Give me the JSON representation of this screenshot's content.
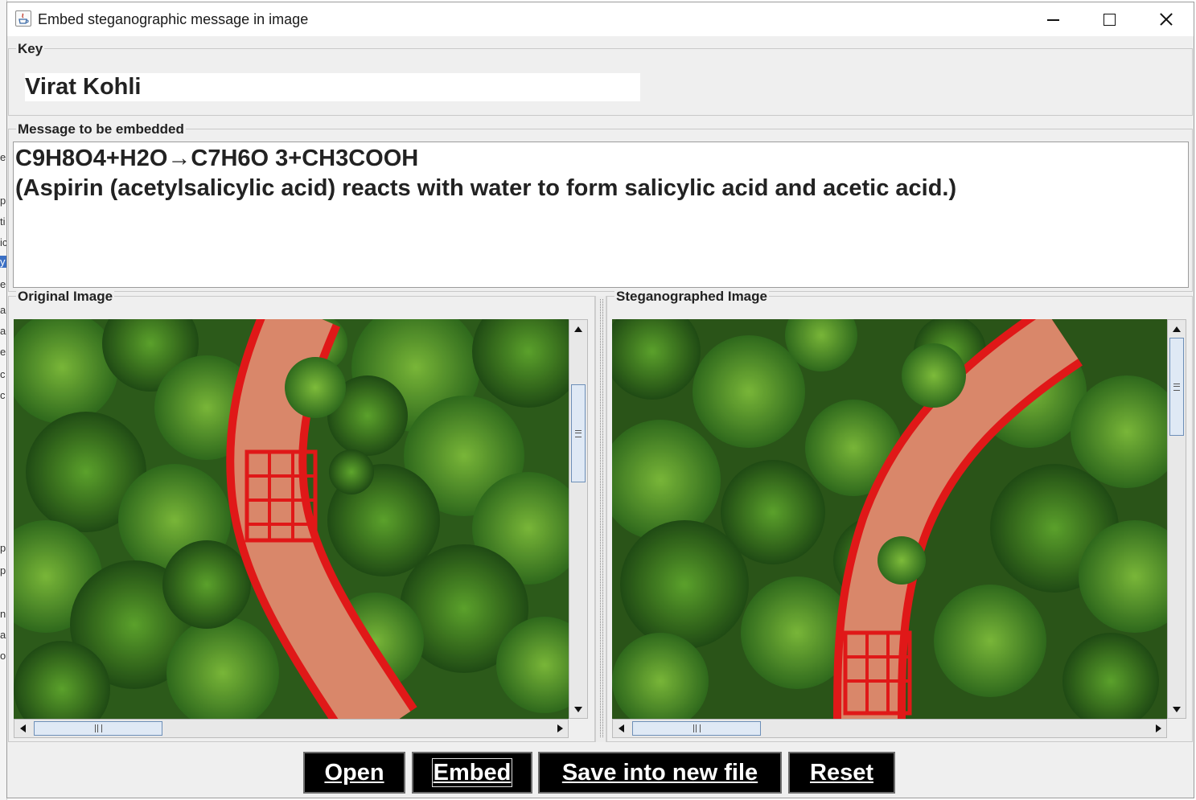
{
  "window": {
    "title": "Embed steganographic message in image"
  },
  "key_panel": {
    "legend": "Key",
    "value": "Virat Kohli"
  },
  "message_panel": {
    "legend": "Message to be embedded",
    "line1": "C9H8O4+H2O→C7H6O 3+CH3COOH",
    "line2": "(Aspirin (acetylsalicylic acid) reacts with water to form salicylic acid and acetic acid.)"
  },
  "original_panel": {
    "legend": "Original Image"
  },
  "stego_panel": {
    "legend": "Steganographed Image"
  },
  "buttons": {
    "open": "Open",
    "embed": "Embed",
    "save": "Save into new file",
    "reset": "Reset"
  },
  "background_fragments": [
    "e",
    "p",
    "ti",
    "ic",
    "y",
    "er",
    "a",
    "a",
    "e",
    "c",
    "c",
    "p",
    "p",
    "n",
    "a",
    "o"
  ],
  "colors": {
    "button_bg": "#000000",
    "button_text": "#ffffff",
    "window_bg": "#efefef",
    "walkway_red": "#e01818",
    "walkway_path": "#d9876a",
    "foliage": "#3f7d24"
  }
}
